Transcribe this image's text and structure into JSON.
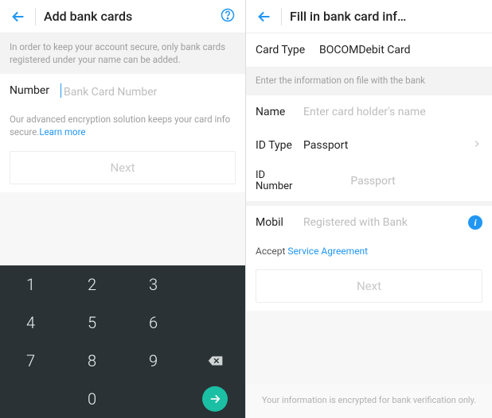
{
  "left": {
    "title": "Add bank cards",
    "intro": "In order to keep your account secure, only bank cards registered under your name can be added.",
    "number_label": "Number",
    "number_placeholder": "Bank Card Number",
    "note_prefix": "Our advanced encryption solution keeps your card info secure.",
    "note_link": "Learn more",
    "next_label": "Next",
    "keypad": {
      "k1": "1",
      "k2": "2",
      "k3": "3",
      "k4": "4",
      "k5": "5",
      "k6": "6",
      "k7": "7",
      "k8": "8",
      "k9": "9",
      "k0": "0"
    }
  },
  "right": {
    "title": "Fill in bank card inf…",
    "card_type_label": "Card Type",
    "card_type_value": "BOCOMDebit Card",
    "banner": "Enter the information on file with the bank",
    "name_label": "Name",
    "name_placeholder": "Enter card holder's name",
    "id_type_label": "ID Type",
    "id_type_value": "Passport",
    "id_number_label": "ID Number",
    "id_number_value": "Passport",
    "mobile_label": "Mobil",
    "mobile_placeholder": "Registered with Bank",
    "accept_prefix": "Accept ",
    "accept_link": "Service Agreement",
    "next_label": "Next",
    "footer": "Your information is encrypted for bank verification only."
  }
}
